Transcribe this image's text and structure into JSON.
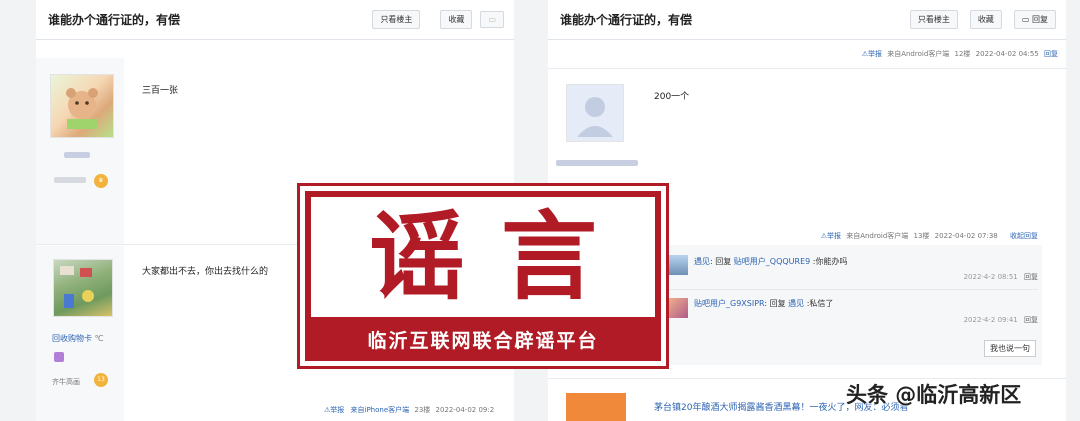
{
  "left_panel": {
    "title": "谁能办个通行证的，有偿",
    "btn_only_owner": "只看楼主",
    "btn_favorite": "收藏",
    "post1": {
      "text": "三百一张"
    },
    "post2": {
      "text": "大家都出不去，你出去找什么的",
      "username": "回收购物卡",
      "username_suffix": "℃",
      "level_name": "齐牛高画",
      "level_num": "13",
      "report": "举报",
      "client": "来自iPhone客户端",
      "floor": "23楼",
      "date": "2022-04-02 09:2"
    }
  },
  "right_panel": {
    "title": "谁能办个通行证的，有偿",
    "btn_only_owner": "只看楼主",
    "btn_favorite": "收藏",
    "btn_reply": "回复",
    "post1_meta": {
      "report": "举报",
      "client": "来自Android客户端",
      "floor": "12楼",
      "date": "2022-04-02 04:55",
      "reply": "回复"
    },
    "post2": {
      "text": "200一个"
    },
    "post2_meta": {
      "report": "举报",
      "client": "来自Android客户端",
      "floor": "13楼",
      "date": "2022-04-02 07:38",
      "collapse": "收起回复"
    },
    "replies": [
      {
        "user": "遇见",
        "action": "回复",
        "target": "贴吧用户_QQQURE9",
        "content": ":你能办吗",
        "time": "2022-4-2 08:51",
        "reply_label": "回复"
      },
      {
        "user": "贴吧用户_G9XSIPR",
        "action": "回复",
        "target": "遇见",
        "content": ":私信了",
        "time": "2022-4-2 09:41",
        "reply_label": "回复"
      }
    ],
    "say_button": "我也说一句",
    "ad_text": "茅台镇20年酿酒大师揭露酱香酒黑幕！一夜火了，网友：必须看"
  },
  "stamp": {
    "word": "谣言",
    "subtitle": "临沂互联网联合辟谣平台"
  },
  "watermark": "头条 @临沂高新区",
  "colors": {
    "stamp_red": "#b01b25",
    "link_blue": "#2d64b3"
  }
}
